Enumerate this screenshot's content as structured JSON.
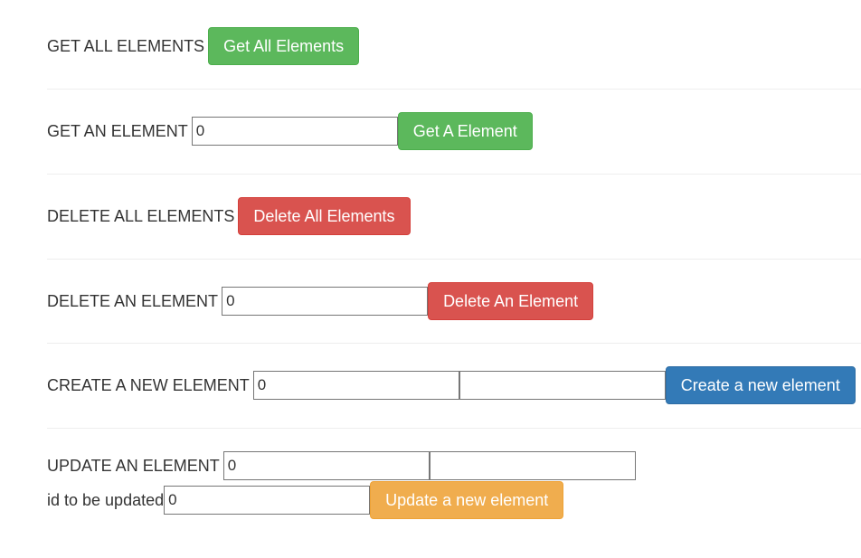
{
  "get_all": {
    "label": "GET ALL ELEMENTS",
    "button": "Get All Elements"
  },
  "get_one": {
    "label": "GET AN ELEMENT",
    "id_value": "0",
    "button": "Get A Element"
  },
  "delete_all": {
    "label": "DELETE ALL ELEMENTS",
    "button": "Delete All Elements"
  },
  "delete_one": {
    "label": "DELETE AN ELEMENT",
    "id_value": "0",
    "button": "Delete An Element"
  },
  "create": {
    "label": "CREATE A NEW ELEMENT",
    "id_value": "0",
    "name_value": "",
    "button": "Create a new element"
  },
  "update": {
    "label": "UPDATE AN ELEMENT",
    "id_value": "0",
    "name_value": "",
    "id_label": "id to be updated",
    "target_id_value": "0",
    "button": "Update a new element"
  },
  "colors": {
    "success": "#5cb85c",
    "danger": "#d9534f",
    "primary": "#337ab7",
    "warning": "#f0ad4e",
    "text": "#333333"
  }
}
